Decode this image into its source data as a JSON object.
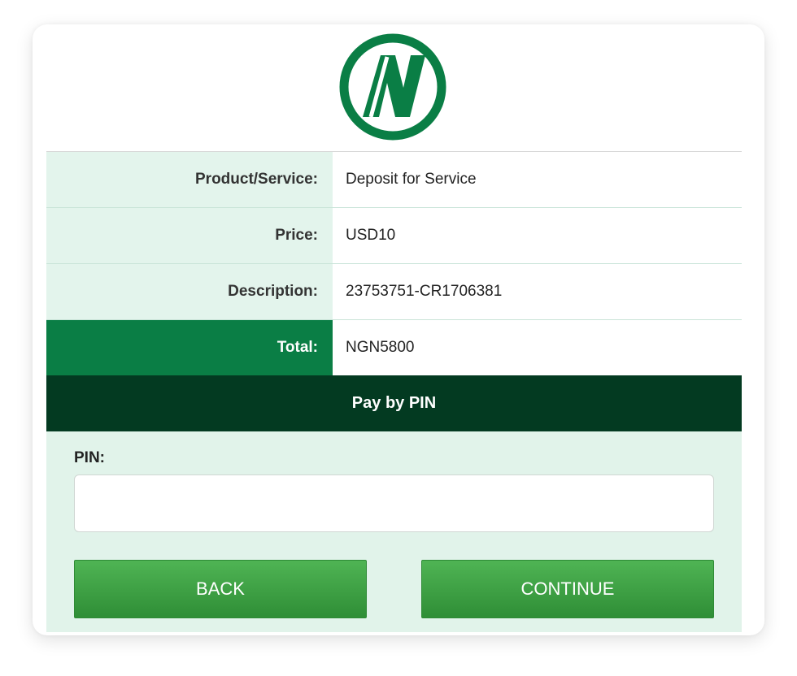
{
  "colors": {
    "brand_green": "#0a7e45",
    "dark_green": "#033a21",
    "light_green": "#e3f4ec",
    "button_green": "#3fa646"
  },
  "logo": {
    "icon": "n-brand-logo-icon"
  },
  "details": {
    "rows": [
      {
        "label": "Product/Service:",
        "value": "Deposit for Service"
      },
      {
        "label": "Price:",
        "value": "USD10"
      },
      {
        "label": "Description:",
        "value": "23753751-CR1706381"
      }
    ],
    "total": {
      "label": "Total:",
      "value": "NGN5800"
    }
  },
  "payment": {
    "header": "Pay by PIN",
    "pin_label": "PIN:",
    "pin_value": "",
    "pin_placeholder": ""
  },
  "buttons": {
    "back": "BACK",
    "continue": "CONTINUE"
  }
}
